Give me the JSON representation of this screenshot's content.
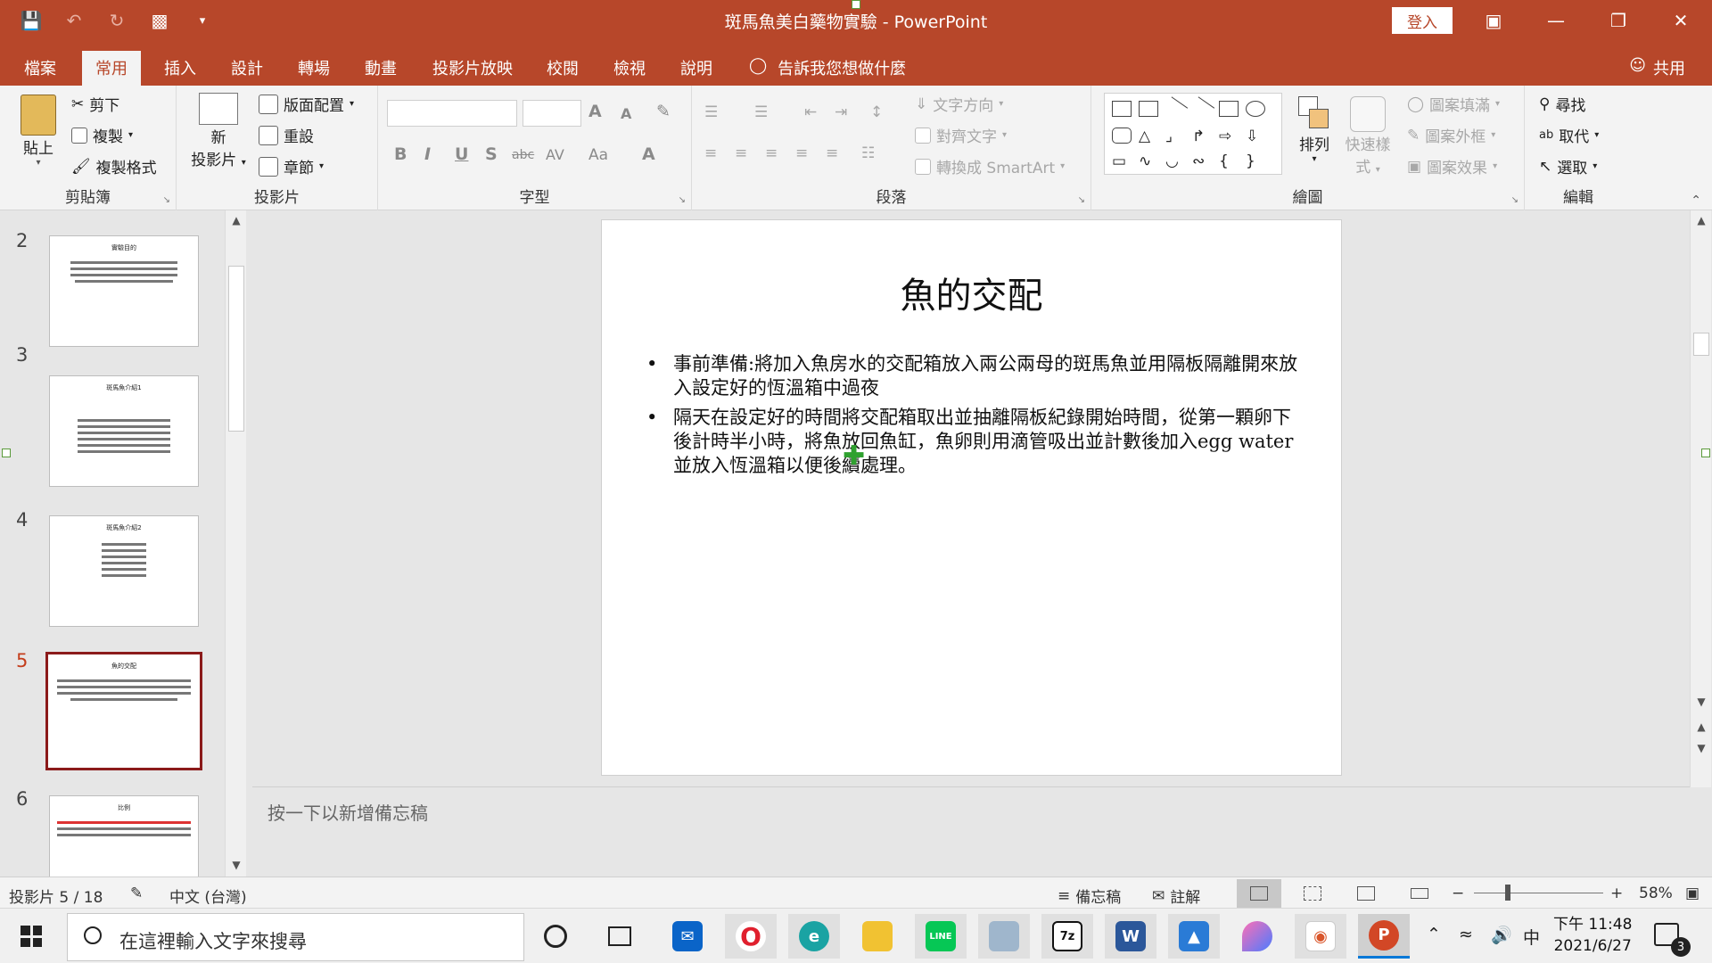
{
  "window": {
    "title": "斑馬魚美白藥物實驗 - PowerPoint",
    "signin": "登入",
    "accent": "#b7472a"
  },
  "tabs": [
    "檔案",
    "常用",
    "插入",
    "設計",
    "轉場",
    "動畫",
    "投影片放映",
    "校閱",
    "檢視",
    "說明"
  ],
  "active_tab": "常用",
  "tellme": "告訴我您想做什麼",
  "share": "共用",
  "ribbon": {
    "clipboard": {
      "label": "剪貼簿",
      "paste": "貼上",
      "cut": "剪下",
      "copy": "複製",
      "format_painter": "複製格式"
    },
    "slides": {
      "label": "投影片",
      "new_slide_1": "新",
      "new_slide_2": "投影片",
      "layout": "版面配置",
      "reset": "重設",
      "section": "章節"
    },
    "font": {
      "label": "字型",
      "bold": "B",
      "italic": "I",
      "underline": "U",
      "shadow": "S",
      "strike": "abc",
      "spacing": "AV",
      "case": "Aa",
      "grow": "A",
      "shrink": "A",
      "color": "A"
    },
    "paragraph": {
      "label": "段落",
      "text_direction": "文字方向",
      "align_text": "對齊文字",
      "smartart": "轉換成 SmartArt"
    },
    "drawing": {
      "label": "繪圖",
      "arrange": "排列",
      "quick_styles_1": "快速樣",
      "quick_styles_2": "式",
      "shape_fill": "圖案填滿",
      "shape_outline": "圖案外框",
      "shape_effects": "圖案效果"
    },
    "editing": {
      "label": "編輯",
      "find": "尋找",
      "replace": "取代",
      "select": "選取"
    }
  },
  "thumbnails": [
    {
      "num": "2",
      "title": "實驗目的"
    },
    {
      "num": "3",
      "title": "斑馬魚介紹1"
    },
    {
      "num": "4",
      "title": "斑馬魚介紹2"
    },
    {
      "num": "5",
      "title": "魚的交配"
    },
    {
      "num": "6",
      "title": "比例"
    }
  ],
  "slide": {
    "title": "魚的交配",
    "bullets": [
      "事前準備:將加入魚房水的交配箱放入兩公兩母的斑馬魚並用隔板隔離開來放入設定好的恆溫箱中過夜",
      "隔天在設定好的時間將交配箱取出並抽離隔板紀錄開始時間，從第一顆卵下後計時半小時，將魚放回魚缸，魚卵則用滴管吸出並計數後加入egg water 並放入恆溫箱以便後續處理。"
    ]
  },
  "notes_placeholder": "按一下以新增備忘稿",
  "status": {
    "slide_count": "投影片 5 / 18",
    "language": "中文 (台灣)",
    "notes": "備忘稿",
    "comments": "註解",
    "zoom_minus": "−",
    "zoom_plus": "+",
    "zoom": "58%",
    "zoom_level_percent": 58
  },
  "taskbar": {
    "search_placeholder": "在這裡輸入文字來搜尋",
    "ime": "中",
    "time": "下午 11:48",
    "date": "2021/6/27",
    "notifications": "3"
  }
}
